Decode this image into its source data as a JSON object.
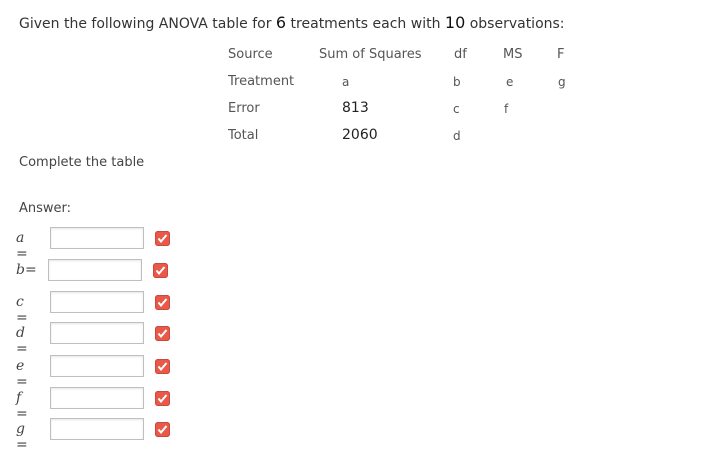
{
  "question": {
    "intro_before": "Given the following ANOVA table for ",
    "treatments": "6",
    "intro_middle": " treatments each with ",
    "observations": "10",
    "intro_after": " observations:"
  },
  "table": {
    "headers": [
      "Source",
      "Sum of Squares",
      "df",
      "MS",
      "F"
    ],
    "rows": [
      [
        "Treatment",
        "a",
        "b",
        "e",
        "g"
      ],
      [
        "Error",
        "813",
        "c",
        "f",
        ""
      ],
      [
        "Total",
        "2060",
        "d",
        "",
        ""
      ]
    ]
  },
  "instruction": "Complete the table",
  "answer_label": "Answer:",
  "answers": [
    {
      "var": "a",
      "eq": "=",
      "value": "",
      "placeholder": ""
    },
    {
      "var": "b",
      "eq": "=",
      "value": "",
      "placeholder": ""
    },
    {
      "var": "c",
      "eq": "=",
      "value": "",
      "placeholder": ""
    },
    {
      "var": "d",
      "eq": "=",
      "value": "",
      "placeholder": ""
    },
    {
      "var": "e",
      "eq": "=",
      "value": "",
      "placeholder": ""
    },
    {
      "var": "f",
      "eq": "=",
      "value": "",
      "placeholder": ""
    },
    {
      "var": "g",
      "eq": "=",
      "value": "",
      "placeholder": ""
    }
  ],
  "icons": {
    "answer_status": "incorrect-check-icon"
  },
  "colors": {
    "status_badge": "#e8594a"
  }
}
